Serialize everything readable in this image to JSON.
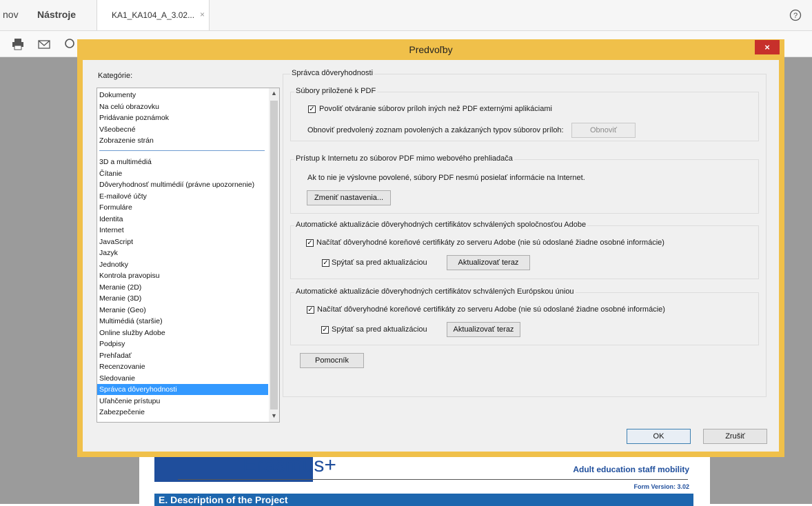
{
  "app": {
    "tabs": [
      "nov",
      "Nástroje"
    ],
    "doc_tab": {
      "label": "KA1_KA104_A_3.02...",
      "close": "×"
    },
    "help_icon": "help-circle-icon"
  },
  "toolbar": {
    "icons": [
      "print-icon",
      "email-icon",
      "search-icon"
    ]
  },
  "document": {
    "brand": "Erasmus+",
    "subtitle": "Adult education staff mobility",
    "form_version": "Form Version: 3.02",
    "section_title": "E. Description of the Project"
  },
  "dialog": {
    "title": "Predvoľby",
    "close": "×",
    "categories_label": "Kategórie:",
    "categories_top": [
      "Dokumenty",
      "Na celú obrazovku",
      "Pridávanie poznámok",
      "Všeobecné",
      "Zobrazenie strán"
    ],
    "categories": [
      "3D a multimédiá",
      "Čítanie",
      "Dôveryhodnosť multimédií (právne upozornenie)",
      "E-mailové účty",
      "Formuláre",
      "Identita",
      "Internet",
      "JavaScript",
      "Jazyk",
      "Jednotky",
      "Kontrola pravopisu",
      "Meranie (2D)",
      "Meranie (3D)",
      "Meranie (Geo)",
      "Multimédiá (staršie)",
      "Online služby Adobe",
      "Podpisy",
      "Prehľadať",
      "Recenzovanie",
      "Sledovanie",
      "Správca dôveryhodnosti",
      "Uľahčenie prístupu",
      "Zabezpečenie"
    ],
    "selected_category": "Správca dôveryhodnosti",
    "panel_title": "Správca dôveryhodnosti",
    "attachments": {
      "legend": "Súbory priložené k PDF",
      "allow_checkbox": "Povoliť otváranie súborov príloh iných než PDF externými aplikáciami",
      "allow_checked": true,
      "restore_text": "Obnoviť predvolený zoznam povolených a zakázaných typov súborov príloh:",
      "restore_button": "Obnoviť"
    },
    "internet": {
      "legend": "Prístup k Internetu zo súborov PDF mimo webového prehliadača",
      "info": "Ak to nie je výslovne povolené, súbory PDF nesmú posielať informácie na Internet.",
      "change_button": "Zmeniť nastavenia..."
    },
    "adobe_updates": {
      "legend": "Automatické aktualizácie dôveryhodných certifikátov schválených spoločnosťou Adobe",
      "load_checkbox": "Načítať dôveryhodné koreňové certifikáty zo serveru Adobe (nie sú odoslané žiadne osobné informácie)",
      "ask_checkbox": "Spýtať sa pred aktualizáciou",
      "update_button": "Aktualizovať teraz"
    },
    "eu_updates": {
      "legend": "Automatické aktualizácie dôveryhodných certifikátov schválených Európskou úniou",
      "load_checkbox": "Načítať dôveryhodné koreňové certifikáty zo serveru Adobe (nie sú odoslané žiadne osobné informácie)",
      "ask_checkbox": "Spýtať sa pred aktualizáciou",
      "update_button": "Aktualizovať teraz"
    },
    "help_button": "Pomocník",
    "ok_button": "OK",
    "cancel_button": "Zrušiť",
    "colors": {
      "frame": "#f0c04a",
      "selection": "#3399ff",
      "close": "#c7302b"
    }
  }
}
